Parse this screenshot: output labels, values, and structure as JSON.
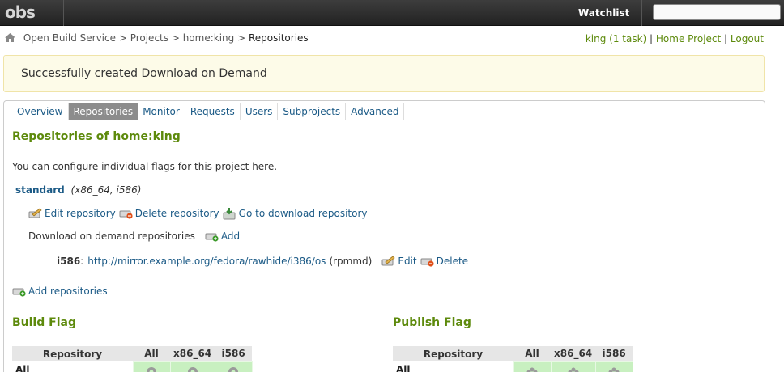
{
  "topbar": {
    "logo_text": "obs",
    "watchlist_label": "Watchlist",
    "search_placeholder": ""
  },
  "breadcrumb": {
    "items": [
      "Open Build Service",
      "Projects",
      "home:king"
    ],
    "current": "Repositories",
    "separator": ">"
  },
  "user_links": {
    "user": "king (1 task)",
    "home_project": "Home Project",
    "logout": "Logout",
    "separator": "|"
  },
  "flash": {
    "message": "Successfully created Download on Demand"
  },
  "tabs": [
    {
      "label": "Overview",
      "active": false
    },
    {
      "label": "Repositories",
      "active": true
    },
    {
      "label": "Monitor",
      "active": false
    },
    {
      "label": "Requests",
      "active": false
    },
    {
      "label": "Users",
      "active": false
    },
    {
      "label": "Subprojects",
      "active": false
    },
    {
      "label": "Advanced",
      "active": false
    }
  ],
  "main": {
    "title": "Repositories of home:king",
    "intro": "You can configure individual flags for this project here.",
    "repository": {
      "name": "standard",
      "archs": "(x86_64, i586)",
      "actions": {
        "edit": "Edit repository",
        "delete": "Delete repository",
        "download": "Go to download repository"
      },
      "dod_label": "Download on demand repositories",
      "dod_add": "Add",
      "dod_entries": [
        {
          "arch": "i586",
          "url": "http://mirror.example.org/fedora/rawhide/i386/os",
          "type": "(rpmmd)",
          "edit": "Edit",
          "delete": "Delete"
        }
      ]
    },
    "add_repositories": "Add repositories",
    "build_flag": {
      "title": "Build Flag",
      "headers": [
        "Repository",
        "All",
        "x86_64",
        "i586"
      ],
      "rows": [
        {
          "label": "All"
        }
      ]
    },
    "publish_flag": {
      "title": "Publish Flag",
      "headers": [
        "Repository",
        "All",
        "x86_64",
        "i586"
      ],
      "rows": [
        {
          "label": "All"
        }
      ]
    }
  },
  "colors": {
    "link": "#1b5a86",
    "heading_green": "#5d8a0c",
    "flag_enabled": "#c8f0c0",
    "flash_bg": "#fdfbe8",
    "active_tab": "#8c8c8c"
  }
}
